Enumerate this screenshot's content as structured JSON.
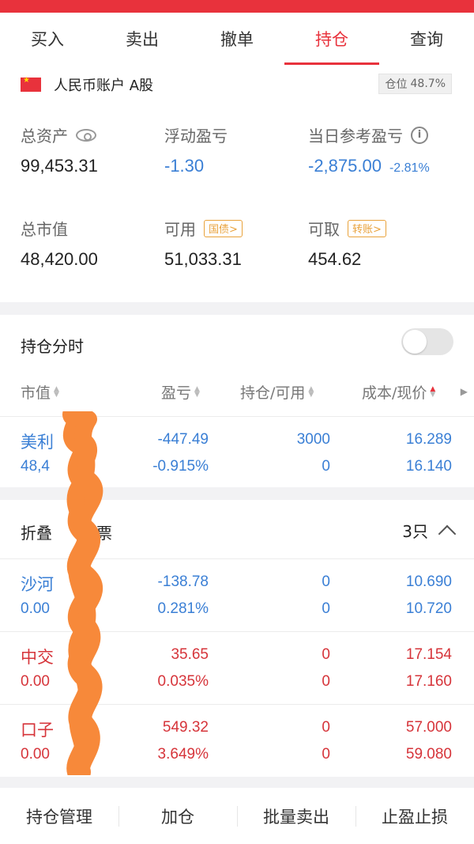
{
  "tabs": [
    {
      "label": "买入"
    },
    {
      "label": "卖出"
    },
    {
      "label": "撤单"
    },
    {
      "label": "持仓"
    },
    {
      "label": "查询"
    }
  ],
  "active_tab": "持仓",
  "account": {
    "name": "人民币账户 A股",
    "position_ratio_label": "仓位",
    "position_ratio": "48.7%",
    "total_assets_label": "总资产",
    "total_assets": "99,453.31",
    "floating_pl_label": "浮动盈亏",
    "floating_pl": "-1.30",
    "daily_pl_label": "当日参考盈亏",
    "daily_pl": "-2,875.00",
    "daily_pl_pct": "-2.81%",
    "market_value_label": "总市值",
    "market_value": "48,420.00",
    "available_label": "可用",
    "available_tag": "国债>",
    "available": "51,033.31",
    "withdrawable_label": "可取",
    "withdrawable_tag": "转账>",
    "withdrawable": "454.62"
  },
  "holdings": {
    "title": "持仓分时",
    "columns": [
      "市值",
      "盈亏",
      "持仓/可用",
      "成本/现价"
    ],
    "rows": [
      {
        "name": "美利",
        "sub": "48,4",
        "pl": "-447.49",
        "pl_pct": "-0.915%",
        "hold": "3000",
        "avail": "0",
        "cost": "16.289",
        "price": "16.140",
        "color": "blue"
      }
    ]
  },
  "folded": {
    "title_a": "折叠",
    "title_b": "票",
    "count": "3只",
    "rows": [
      {
        "name": "沙河",
        "sub": "0.00",
        "pl": "-138.78",
        "pl_pct": "0.281%",
        "hold": "0",
        "avail": "0",
        "cost": "10.690",
        "price": "10.720",
        "color": "blue"
      },
      {
        "name": "中交",
        "sub": "0.00",
        "pl": "35.65",
        "pl_pct": "0.035%",
        "hold": "0",
        "avail": "0",
        "cost": "17.154",
        "price": "17.160",
        "color": "red"
      },
      {
        "name": "口子",
        "sub": "0.00",
        "pl": "549.32",
        "pl_pct": "3.649%",
        "hold": "0",
        "avail": "0",
        "cost": "57.000",
        "price": "59.080",
        "color": "red"
      }
    ]
  },
  "bottom_actions": [
    "持仓管理",
    "加仓",
    "批量卖出",
    "止盈止损"
  ],
  "colors": {
    "accent": "#e8323c",
    "up": "#d6343a",
    "down": "#3a7fd5",
    "tag": "#e9a23b",
    "redaction": "#f7893a"
  }
}
